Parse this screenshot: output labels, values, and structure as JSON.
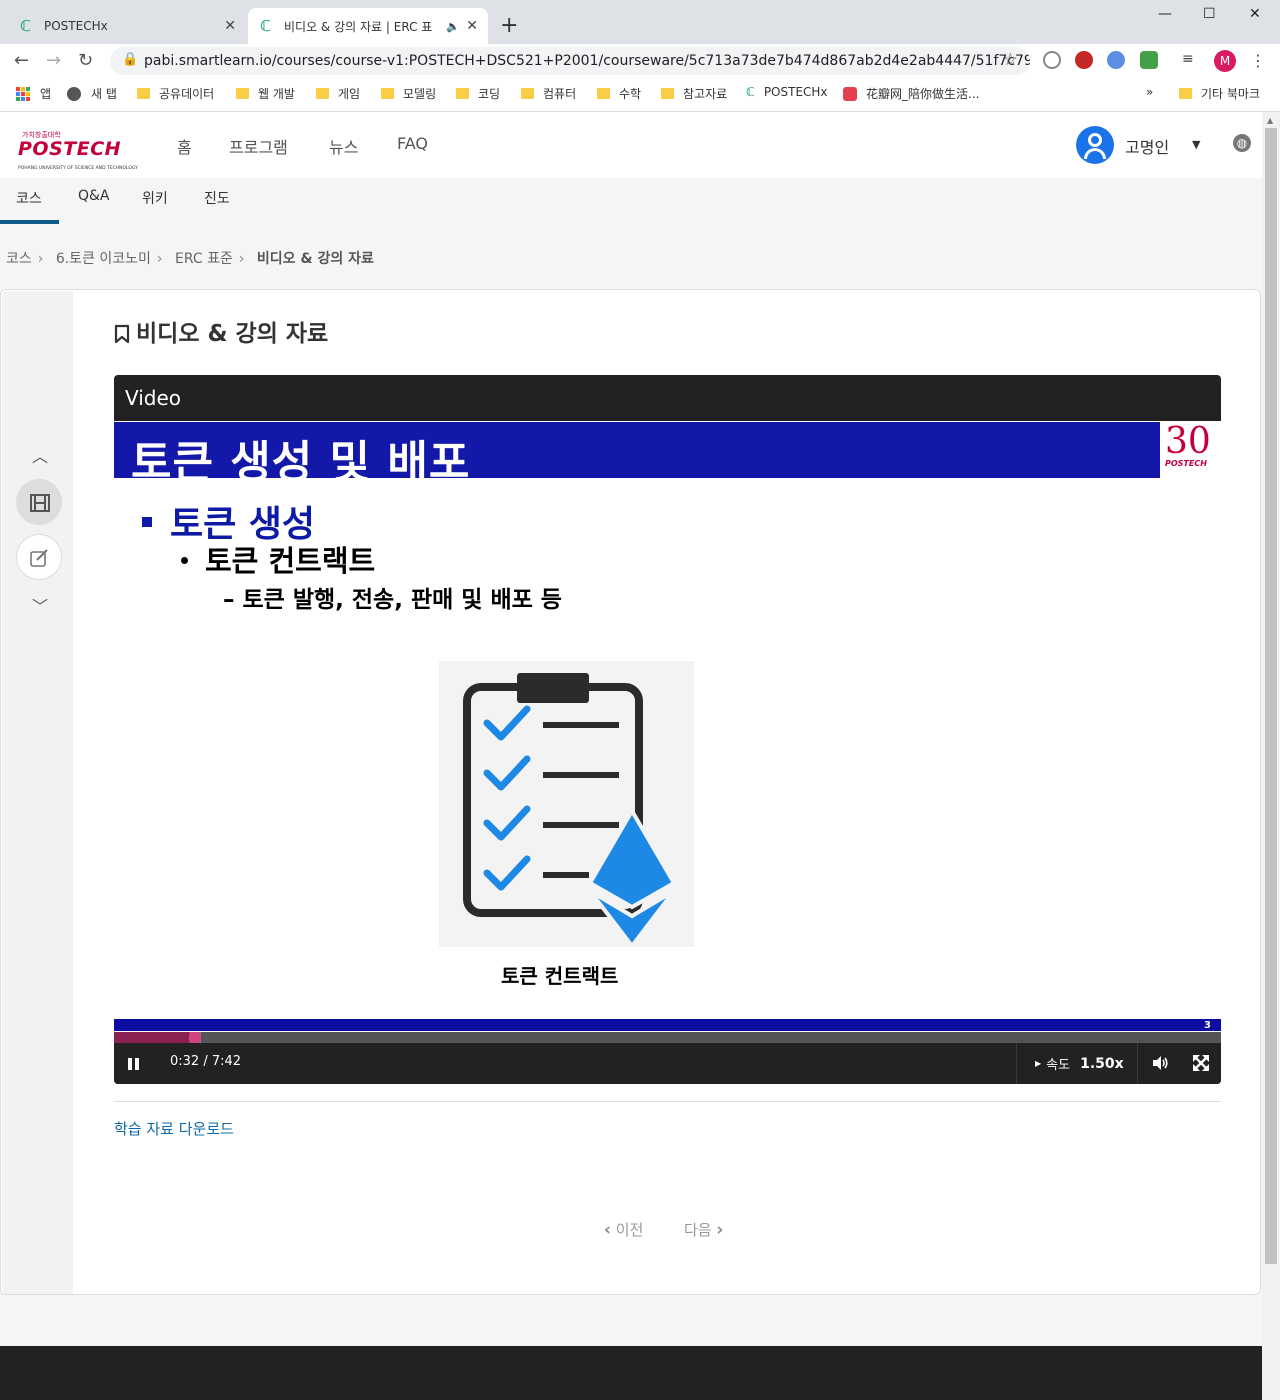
{
  "browser": {
    "tabs": [
      {
        "title": "POSTECHx",
        "active": false
      },
      {
        "title": "비디오 & 강의 자료 | ERC 표",
        "active": true
      }
    ],
    "new_tab_symbol": "+",
    "url": "pabi.smartlearn.io/courses/course-v1:POSTECH+DSC521+P2001/courseware/5c713a73de7b474d867ab2d4e2ab4447/51f7c794931149f...",
    "profile_initial": "M",
    "bookmarks": [
      {
        "label": "앱",
        "type": "apps"
      },
      {
        "label": "새 탭",
        "type": "globe"
      },
      {
        "label": "공유데이터",
        "type": "folder"
      },
      {
        "label": "웹 개발",
        "type": "folder"
      },
      {
        "label": "게임",
        "type": "folder"
      },
      {
        "label": "모델링",
        "type": "folder"
      },
      {
        "label": "코딩",
        "type": "folder"
      },
      {
        "label": "컴퓨터",
        "type": "folder"
      },
      {
        "label": "수학",
        "type": "folder"
      },
      {
        "label": "참고자료",
        "type": "folder"
      },
      {
        "label": "POSTECHx",
        "type": "site"
      },
      {
        "label": "花瓣网_陪你做生活...",
        "type": "site"
      }
    ],
    "bookmarks_overflow": "»",
    "other_bookmarks": "기타 북마크",
    "accent": "#1a73e8"
  },
  "site": {
    "logo": {
      "tagline": "가치창출대학",
      "name": "POSTECH",
      "subtitle": "POHANG UNIVERSITY OF SCIENCE AND TECHNOLOGY"
    },
    "nav": [
      "홈",
      "프로그램",
      "뉴스",
      "FAQ"
    ],
    "user_name": "고명인",
    "course_tabs": [
      "코스",
      "Q&A",
      "위키",
      "진도"
    ],
    "breadcrumb": [
      "코스",
      "6.토큰 이코노미",
      "ERC 표준",
      "비디오 & 강의 자료"
    ],
    "unit_title": "비디오 & 강의 자료",
    "brand_color": "#c4003b"
  },
  "video": {
    "label": "Video",
    "slide": {
      "title": "토큰 생성 및 배포",
      "bullet1": "토큰 생성",
      "bullet2": "토큰 컨트랙트",
      "bullet3": "– 토큰 발행, 전송, 판매 및 배포 등",
      "image_caption": "토큰 컨트랙트",
      "page_number": "3",
      "logo_number": "30",
      "logo_name": "POSTECH"
    },
    "time": "0:32 / 7:42",
    "progress_fraction": 0.069,
    "buffered_fraction": 0.079,
    "speed_label": "속도",
    "speed_value": "1.50x"
  },
  "download_link": "학습 자료 다운로드",
  "pager": {
    "prev": "이전",
    "next": "다음"
  }
}
